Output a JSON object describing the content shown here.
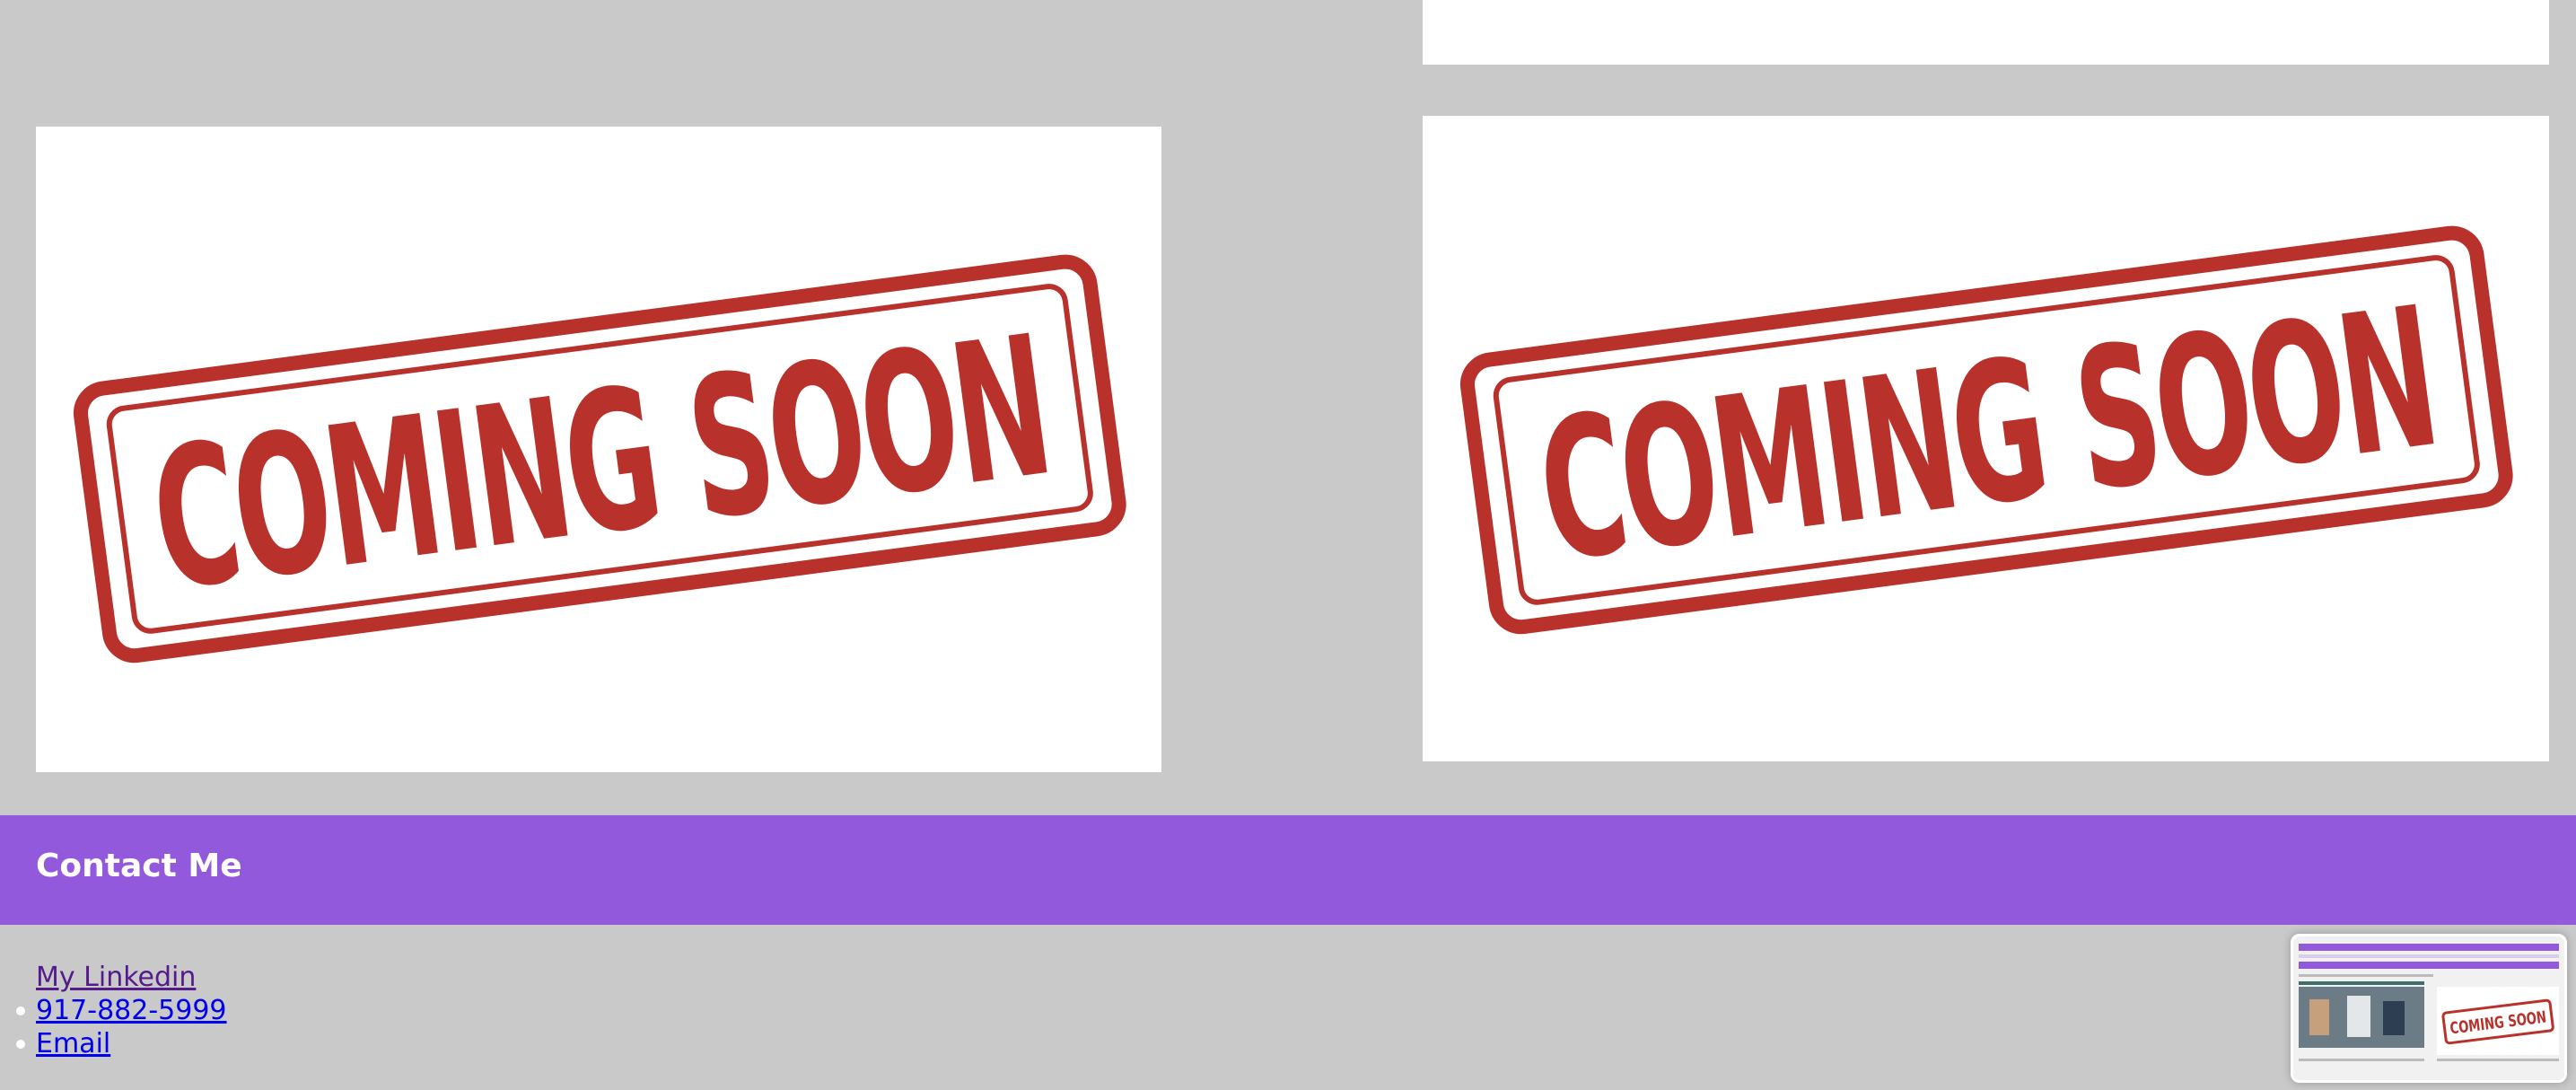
{
  "cards": {
    "top_right": {},
    "left": {
      "stamp_text": "COMING SOON"
    },
    "right": {
      "stamp_text": "COMING SOON"
    }
  },
  "contact": {
    "title": "Contact Me",
    "links": [
      {
        "label": "My Linkedin",
        "visited": true
      },
      {
        "label": "917-882-5999",
        "visited": false
      },
      {
        "label": "Email",
        "visited": false
      }
    ]
  },
  "thumbnail": {
    "stamp_text": "COMING SOON"
  },
  "colors": {
    "accent": "#9359dc",
    "background": "#c9c9c9",
    "stamp_red": "#b8312a",
    "link": "#0000ee",
    "link_visited": "#551a8b"
  }
}
